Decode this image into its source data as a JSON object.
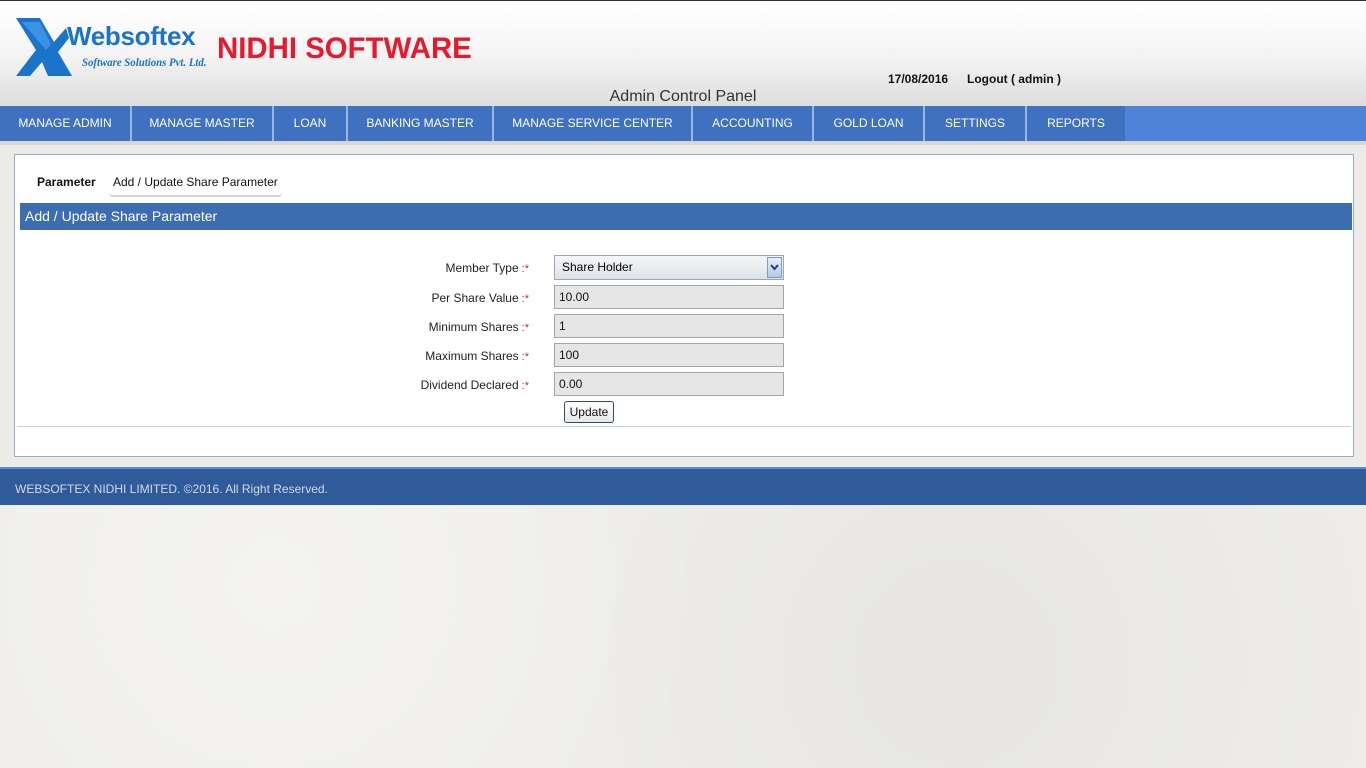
{
  "header": {
    "brand_name": "Websoftex",
    "brand_sub": "Software Solutions Pvt. Ltd.",
    "product_name": "NIDHI SOFTWARE",
    "date": "17/08/2016",
    "logout": "Logout ( admin )",
    "panel_title": "Admin Control Panel"
  },
  "nav": {
    "items": [
      {
        "label": "MANAGE ADMIN"
      },
      {
        "label": "MANAGE MASTER"
      },
      {
        "label": "LOAN"
      },
      {
        "label": "BANKING MASTER"
      },
      {
        "label": "MANAGE SERVICE CENTER"
      },
      {
        "label": "ACCOUNTING"
      },
      {
        "label": "GOLD LOAN"
      },
      {
        "label": "SETTINGS"
      },
      {
        "label": "REPORTS"
      }
    ]
  },
  "tabs": {
    "group_label": "Parameter",
    "active_tab": "Add / Update Share Parameter"
  },
  "section": {
    "title": "Add / Update Share Parameter"
  },
  "form": {
    "required_marker": ":*",
    "member_type": {
      "label": "Member Type",
      "value": "Share Holder"
    },
    "per_share_value": {
      "label": "Per Share Value",
      "value": "10.00"
    },
    "minimum_shares": {
      "label": "Minimum Shares",
      "value": "1"
    },
    "maximum_shares": {
      "label": "Maximum Shares",
      "value": "100"
    },
    "dividend_declared": {
      "label": "Dividend Declared",
      "value": "0.00"
    },
    "update_label": "Update"
  },
  "footer": {
    "text": "WEBSOFTEX NIDHI LIMITED. ©2016. All Right Reserved."
  },
  "colors": {
    "nav_bg": "#4f83d7",
    "nav_item_bg": "#3f71c0",
    "section_bar": "#3c6db0",
    "footer_bg": "#305a99",
    "brand_blue": "#1a74c9",
    "product_red": "#e8192c"
  }
}
